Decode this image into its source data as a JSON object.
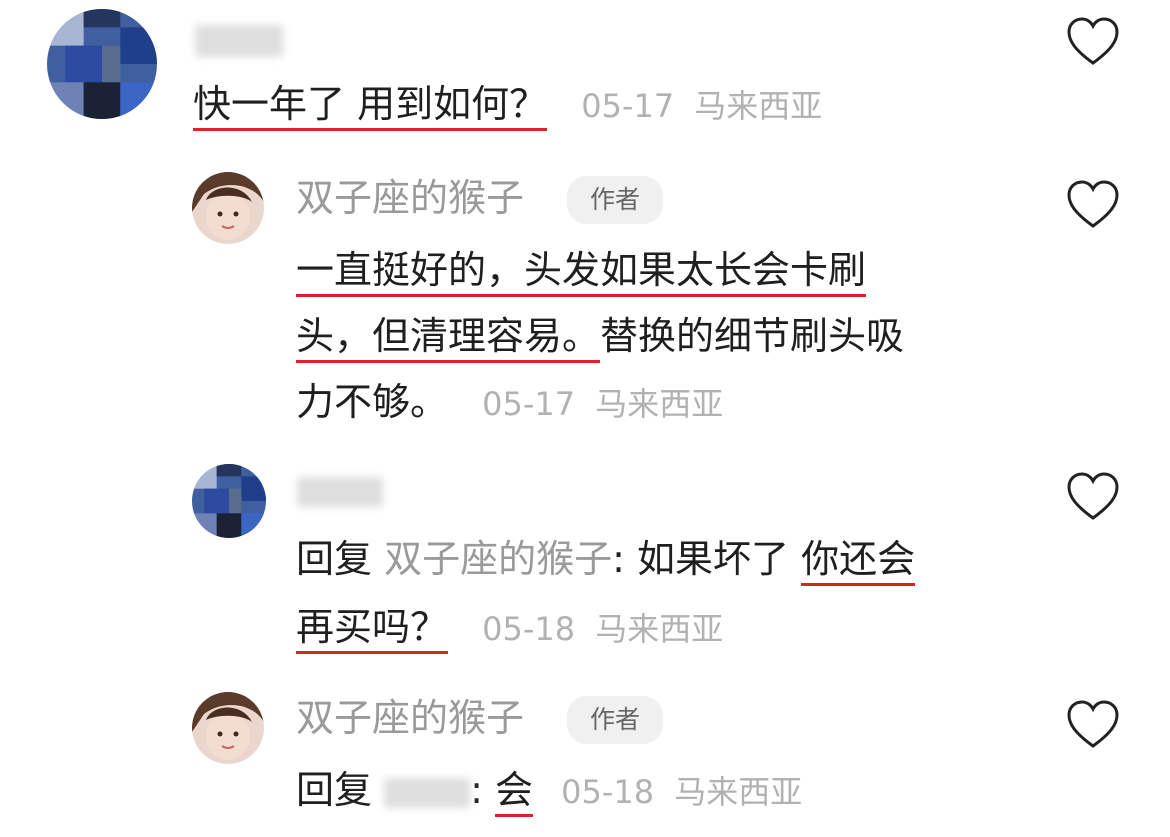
{
  "comments": [
    {
      "user_name": "",
      "text_parts": [
        "快一年了 用到如何？"
      ],
      "date": "05-17",
      "location": "马来西亚",
      "liked": false
    },
    {
      "user_name": "双子座的猴子",
      "badge": "作者",
      "text_line1_underlined": "一直挺好的，头发如果太长会卡刷",
      "text_line2_underlined": "头，但清理容易。",
      "text_line2_rest": "替换的细节刷头吸",
      "text_line3": "力不够。",
      "date": "05-17",
      "location": "马来西亚",
      "liked": false
    },
    {
      "user_name": "",
      "reply_prefix": "回复",
      "reply_target": "双子座的猴子",
      "colon": ":",
      "text_line1_plain": "如果坏了 ",
      "text_line1_underlined": "你还会",
      "text_line2_underlined": "再买吗？",
      "date": "05-18",
      "location": "马来西亚",
      "liked": false
    },
    {
      "user_name": "双子座的猴子",
      "badge": "作者",
      "reply_prefix": "回复",
      "reply_target": "",
      "colon": ":",
      "text_underlined": "会",
      "date": "05-18",
      "location": "马来西亚",
      "liked": false
    }
  ],
  "colors": {
    "underline": "#d9252a",
    "meta_gray": "#b2b2b2",
    "name_gray": "#9a9a9a"
  },
  "icons": {
    "like": "heart-outline-icon"
  }
}
